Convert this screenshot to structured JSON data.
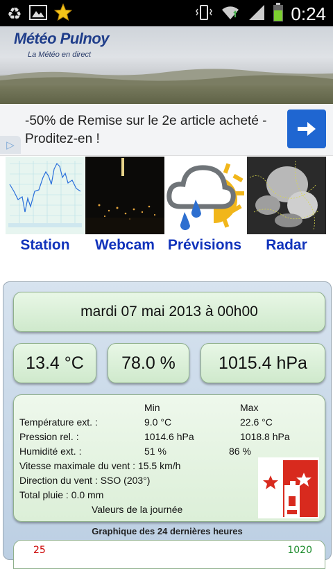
{
  "status_bar": {
    "time": "0:24",
    "left_icons": [
      "recycle-icon",
      "image-icon",
      "star-icon"
    ],
    "right_icons": [
      "vibrate-icon",
      "wifi-icon",
      "signal-icon",
      "battery-icon"
    ]
  },
  "banner": {
    "title": "Météo Pulnoy",
    "subtitle": "La Météo en direct"
  },
  "ad": {
    "text": "-50% de Remise sur le 2e article acheté - Proditez-en !",
    "button_icon": "arrow-right-icon"
  },
  "nav": [
    {
      "label": "Station"
    },
    {
      "label": "Webcam"
    },
    {
      "label": "Prévisions"
    },
    {
      "label": "Radar"
    }
  ],
  "weather": {
    "date": "mardi 07 mai 2013 à 00h00",
    "temperature": "13.4 °C",
    "humidity": "78.0 %",
    "pressure": "1015.4 hPa",
    "stats": {
      "min_header": "Min",
      "max_header": "Max",
      "temp_label": "Température ext. :",
      "temp_min": "9.0 °C",
      "temp_max": "22.6 °C",
      "pressure_label": "Pression rel. :",
      "pressure_min": "1014.6 hPa",
      "pressure_max": "1018.8 hPa",
      "humidity_label": "Humidité ext. :",
      "humidity_min": "51 %",
      "humidity_max": "86 %",
      "wind_max": "Vitesse maximale du vent : 15.5 km/h",
      "wind_dir": "Direction du vent : SSO (203°)",
      "rain": "Total pluie : 0.0 mm",
      "footer": "Valeurs de la journée"
    },
    "graph_title": "Graphique des 24 dernières heures",
    "graph_left_value": "25",
    "graph_right_value": "1020"
  },
  "colors": {
    "nav_label": "#1133bb",
    "ad_button": "#1f66d1",
    "pill_green": "#dcefd8"
  }
}
